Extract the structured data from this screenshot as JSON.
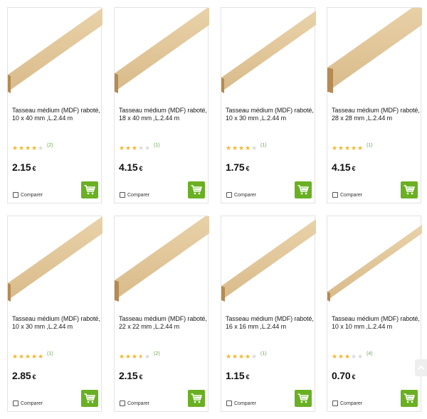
{
  "products": [
    {
      "title": "Tasseau médium (MDF) raboté, 10 x 40 mm ,L.2.44 m",
      "stars": 4,
      "count": "(2)",
      "price": "2.15",
      "currency": "€",
      "compare": "Comparer",
      "icon": "mdf-strip-image"
    },
    {
      "title": "Tasseau médium (MDF) raboté, 18 x 40 mm ,L.2.44 m",
      "stars": 3,
      "count": "(1)",
      "price": "4.15",
      "currency": "€",
      "compare": "Comparer",
      "icon": "mdf-strip-image"
    },
    {
      "title": "Tasseau médium (MDF) raboté, 10 x 30 mm ,L.2.44 m",
      "stars": 4,
      "count": "(1)",
      "price": "1.75",
      "currency": "€",
      "compare": "Comparer",
      "icon": "mdf-strip-image"
    },
    {
      "title": "Tasseau médium (MDF) raboté, 28 x 28 mm ,L.2.44 m",
      "stars": 5,
      "count": "(1)",
      "price": "4.15",
      "currency": "€",
      "compare": "Comparer",
      "icon": "mdf-strip-image"
    },
    {
      "title": "Tasseau médium (MDF) raboté, 10 x 30 mm ,L.2.44 m",
      "stars": 5,
      "count": "(1)",
      "price": "2.85",
      "currency": "€",
      "compare": "Comparer",
      "icon": "mdf-strip-image"
    },
    {
      "title": "Tasseau médium (MDF) raboté, 22 x 22 mm ,L.2.44 m",
      "stars": 3.5,
      "count": "(2)",
      "price": "2.15",
      "currency": "€",
      "compare": "Comparer",
      "icon": "mdf-strip-image"
    },
    {
      "title": "Tasseau médium (MDF) raboté, 16 x 16 mm ,L.2.44 m",
      "stars": 4,
      "count": "(1)",
      "price": "1.15",
      "currency": "€",
      "compare": "Comparer",
      "icon": "mdf-strip-image"
    },
    {
      "title": "Tasseau médium (MDF) raboté, 10 x 10 mm ,L.2.44 m",
      "stars": 3,
      "count": "(4)",
      "price": "0.70",
      "currency": "€",
      "compare": "Comparer",
      "icon": "mdf-strip-image"
    }
  ],
  "colors": {
    "cart_button": "#6ab023",
    "star": "#f3b72b",
    "count": "#6aa84f",
    "wood_light": "#e9d2a9",
    "wood_dark": "#b68a52"
  },
  "icons": {
    "cart": "shopping-cart-icon",
    "scroll_top": "chevron-up-icon"
  }
}
